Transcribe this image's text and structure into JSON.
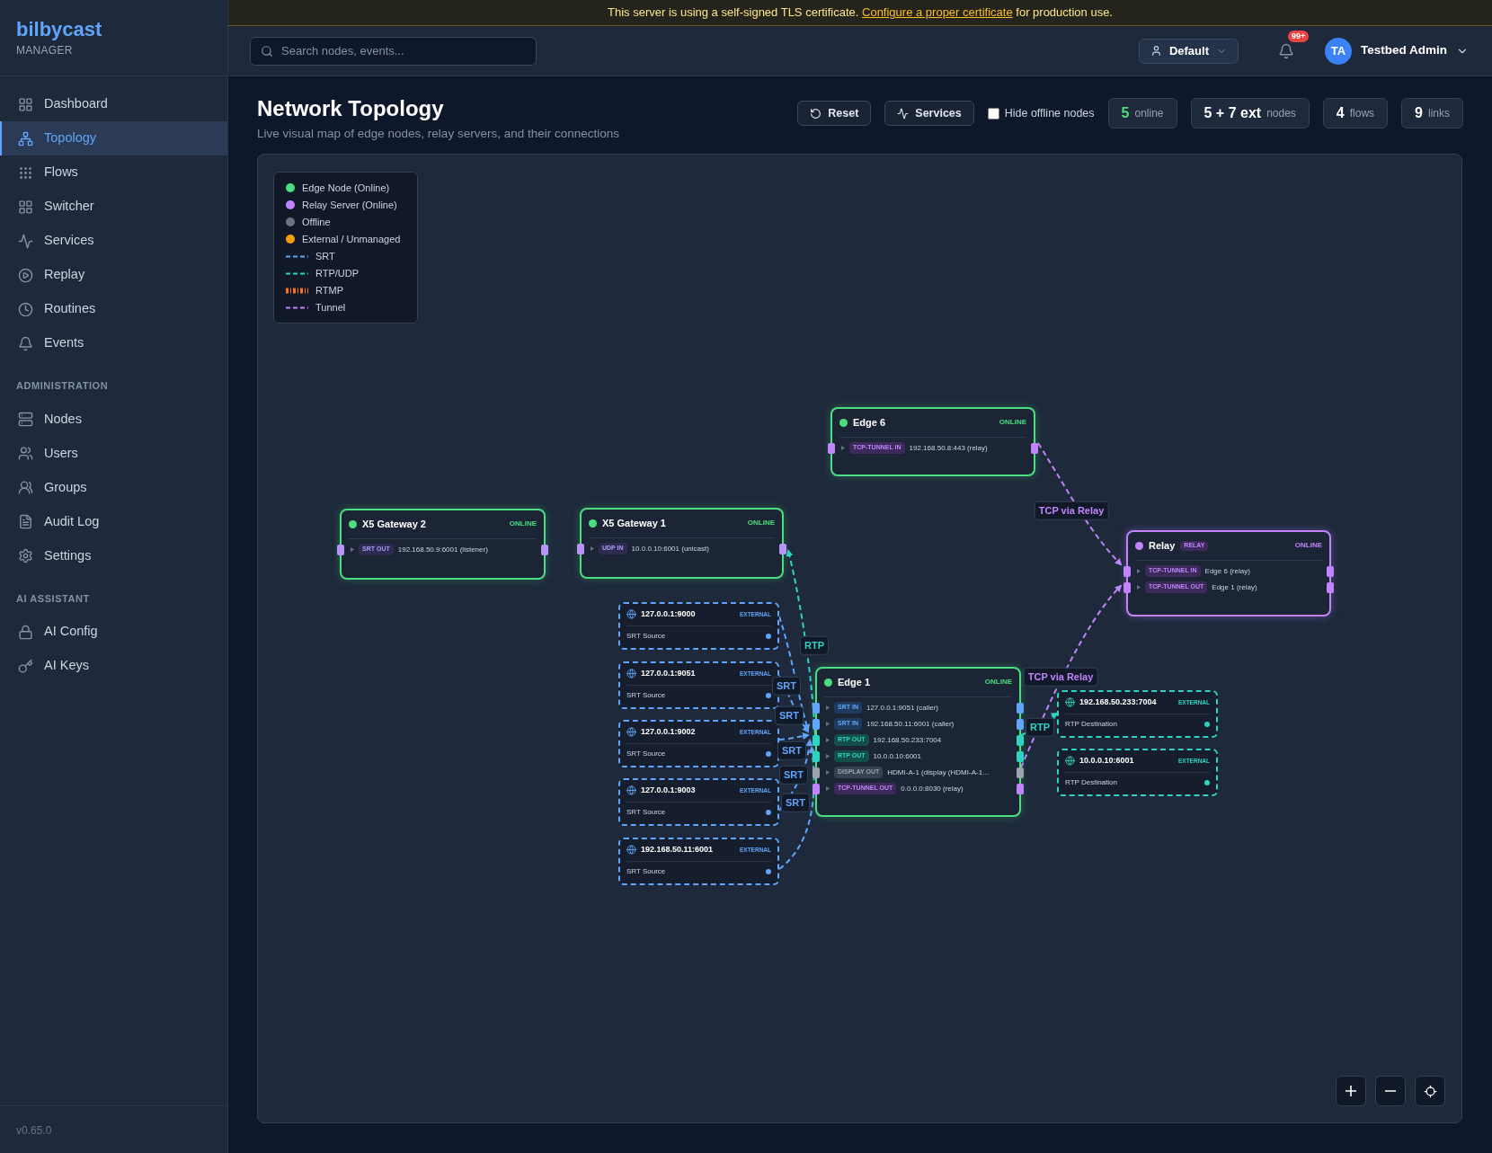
{
  "banner": {
    "before": "This server is using a self-signed TLS certificate.",
    "link": "Configure a proper certificate",
    "after": "for production use."
  },
  "sidebar": {
    "brand": "bilbycast",
    "subtitle": "MANAGER",
    "version": "v0.65.0",
    "sections": [
      {
        "items": [
          {
            "label": "Dashboard",
            "selected": false
          },
          {
            "label": "Topology",
            "selected": true
          },
          {
            "label": "Flows",
            "selected": false
          },
          {
            "label": "Switcher",
            "selected": false
          },
          {
            "label": "Services",
            "selected": false
          },
          {
            "label": "Replay",
            "selected": false
          },
          {
            "label": "Routines",
            "selected": false
          },
          {
            "label": "Events",
            "selected": false
          }
        ]
      },
      {
        "heading": "ADMINISTRATION",
        "items": [
          {
            "label": "Nodes",
            "selected": false
          },
          {
            "label": "Users",
            "selected": false
          },
          {
            "label": "Groups",
            "selected": false
          },
          {
            "label": "Audit Log",
            "selected": false
          },
          {
            "label": "Settings",
            "selected": false
          }
        ]
      },
      {
        "heading": "AI ASSISTANT",
        "items": [
          {
            "label": "AI Config",
            "selected": false
          },
          {
            "label": "AI Keys",
            "selected": false
          }
        ]
      }
    ]
  },
  "header": {
    "search": {
      "placeholder": "Search nodes, events..."
    },
    "workspace": "Default",
    "notifications": "99+",
    "user": {
      "initials": "TA",
      "name": "Testbed Admin"
    }
  },
  "page": {
    "title": "Network Topology",
    "subtitle": "Live visual map of edge nodes, relay servers, and their connections",
    "buttons": [
      "Reset",
      "Services"
    ],
    "hide_offline": {
      "label": "Hide offline nodes",
      "checked": false
    },
    "stats": [
      {
        "value": "5",
        "label": "online",
        "kind": "online"
      },
      {
        "value": "5 + 7 ext",
        "label": "nodes",
        "kind": "count"
      },
      {
        "value": "4",
        "label": "flows",
        "kind": "count"
      },
      {
        "value": "9",
        "label": "links",
        "kind": "count"
      }
    ]
  },
  "legend": [
    {
      "label": "Edge Node (Online)",
      "kind": "node",
      "color": "#4ade80"
    },
    {
      "label": "Relay Server (Online)",
      "kind": "node",
      "color": "#c084fc"
    },
    {
      "label": "Offline",
      "kind": "node",
      "color": "#6b7280"
    },
    {
      "label": "External / Unmanaged",
      "kind": "node",
      "color": "#f59e0b"
    },
    {
      "label": "SRT",
      "kind": "link",
      "color": "#60a5fa"
    },
    {
      "label": "RTP/UDP",
      "kind": "link",
      "color": "#2dd4bf"
    },
    {
      "label": "RTMP",
      "kind": "thick_link",
      "color": "#f97316"
    },
    {
      "label": "Tunnel",
      "kind": "link",
      "color": "#c084fc"
    }
  ],
  "nodes": [
    {
      "name": "Edge 6",
      "kind": "edge",
      "status": "ONLINE",
      "ports": [
        {
          "label": "TCP-TUNNEL IN",
          "address": "192.168.50.8:443 (relay)",
          "kind": "tunnel"
        }
      ]
    },
    {
      "name": "X5 Gateway 2",
      "kind": "edge",
      "status": "ONLINE",
      "ports": [
        {
          "label": "SRT OUT",
          "address": "192.168.50.9:6001 (listener)",
          "kind": "unlinked"
        }
      ]
    },
    {
      "name": "X5 Gateway 1",
      "kind": "edge",
      "status": "ONLINE",
      "ports": [
        {
          "label": "UDP IN",
          "address": "10.0.0.10:6001 (unicast)",
          "kind": "unlinked"
        }
      ]
    },
    {
      "name": "Relay",
      "kind": "relay",
      "badge": "RELAY",
      "status": "ONLINE",
      "ports": [
        {
          "label": "TCP-TUNNEL IN",
          "address": "Edge 6 (relay)",
          "kind": "tunnel"
        },
        {
          "label": "TCP-TUNNEL OUT",
          "address": "Edge 1 (relay)",
          "kind": "tunnel"
        }
      ]
    },
    {
      "name": "Edge 1",
      "kind": "edge",
      "status": "ONLINE",
      "ports": [
        {
          "label": "SRT IN",
          "address": "127.0.0.1:9051 (caller)",
          "kind": "srt"
        },
        {
          "label": "SRT IN",
          "address": "192.168.50.11:6001 (caller)",
          "kind": "srt"
        },
        {
          "label": "RTP OUT",
          "address": "192.168.50.233:7004",
          "kind": "rtp"
        },
        {
          "label": "RTP OUT",
          "address": "10.0.0.10:6001",
          "kind": "rtp"
        },
        {
          "label": "DISPLAY OUT",
          "address": "HDMI-A-1 (display (HDMI-A-1…",
          "kind": "display"
        },
        {
          "label": "TCP-TUNNEL OUT",
          "address": "0.0.0.0:8030 (relay)",
          "kind": "tunnel"
        }
      ]
    }
  ],
  "externals": [
    {
      "address": "127.0.0.1:9000",
      "badge": "EXTERNAL",
      "role": "SRT Source",
      "kind": "srt"
    },
    {
      "address": "127.0.0.1:9051",
      "badge": "EXTERNAL",
      "role": "SRT Source",
      "kind": "srt"
    },
    {
      "address": "127.0.0.1:9002",
      "badge": "EXTERNAL",
      "role": "SRT Source",
      "kind": "srt"
    },
    {
      "address": "127.0.0.1:9003",
      "badge": "EXTERNAL",
      "role": "SRT Source",
      "kind": "srt"
    },
    {
      "address": "192.168.50.11:6001",
      "badge": "EXTERNAL",
      "role": "SRT Source",
      "kind": "srt"
    },
    {
      "address": "192.168.50.233:7004",
      "badge": "EXTERNAL",
      "role": "RTP Destination",
      "kind": "rtp"
    },
    {
      "address": "10.0.0.10:6001",
      "badge": "EXTERNAL",
      "role": "RTP Destination",
      "kind": "rtp"
    }
  ],
  "edges": [
    {
      "label": "TCP via Relay",
      "kind": "tunnel"
    },
    {
      "label": "RTP",
      "kind": "rtp"
    },
    {
      "label": "SRT",
      "kind": "srt"
    },
    {
      "label": "SRT",
      "kind": "srt"
    },
    {
      "label": "SRT",
      "kind": "srt"
    },
    {
      "label": "SRT",
      "kind": "srt"
    },
    {
      "label": "SRT",
      "kind": "srt"
    },
    {
      "label": "TCP via Relay",
      "kind": "tunnel"
    },
    {
      "label": "RTP",
      "kind": "rtp"
    }
  ]
}
